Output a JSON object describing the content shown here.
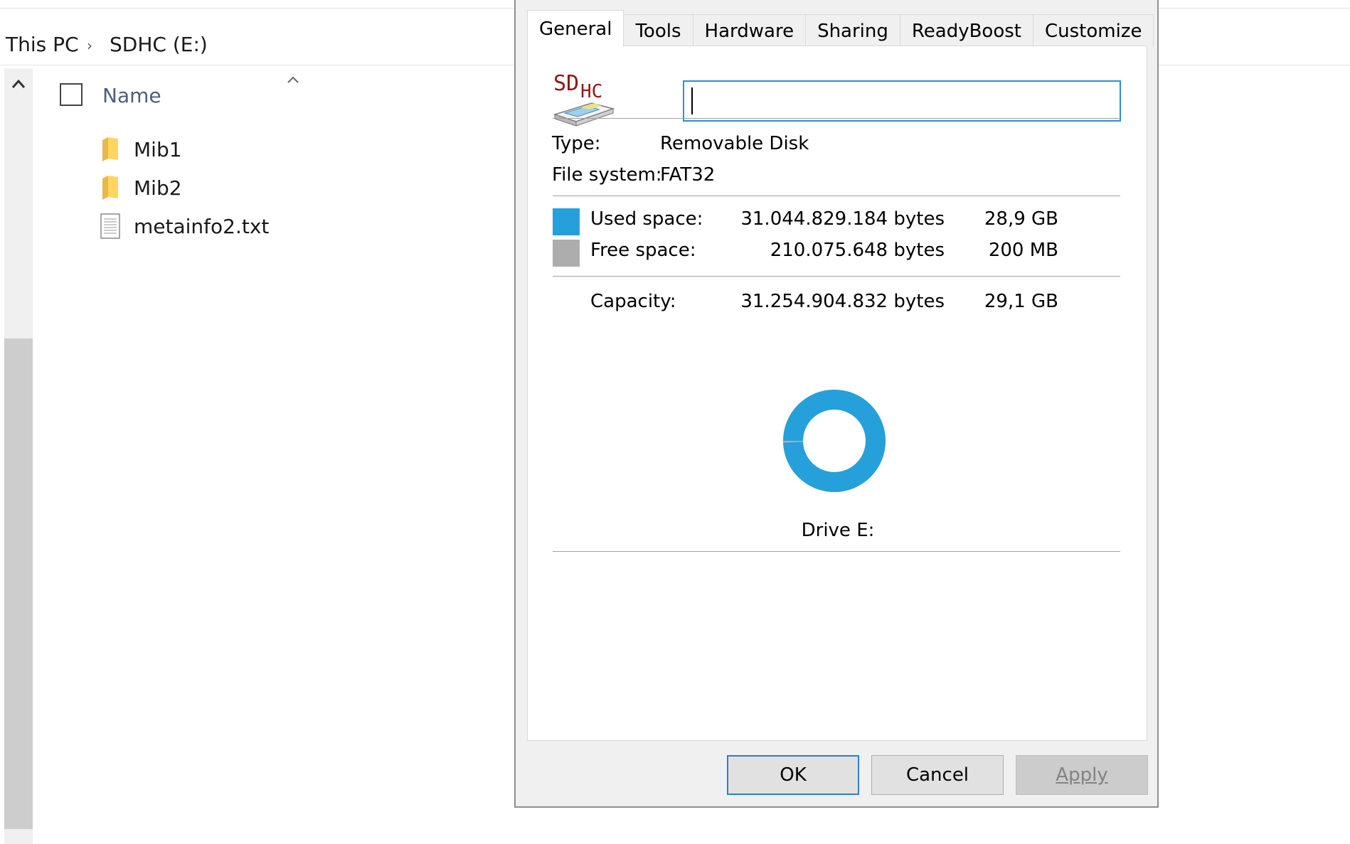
{
  "explorer": {
    "breadcrumb": [
      "This PC",
      "SDHC (E:)"
    ],
    "column_name": "Name",
    "files": [
      {
        "name": "Mib1",
        "type": "folder"
      },
      {
        "name": "Mib2",
        "type": "folder"
      },
      {
        "name": "metainfo2.txt",
        "type": "text-file"
      }
    ]
  },
  "dialog": {
    "tabs": [
      "General",
      "Tools",
      "Hardware",
      "Sharing",
      "ReadyBoost",
      "Customize"
    ],
    "active_tab": "General",
    "drive_logo": "SDHC",
    "label_value": "",
    "type_label": "Type:",
    "type_value": "Removable Disk",
    "fs_label": "File system:",
    "fs_value": "FAT32",
    "used_label": "Used space:",
    "used_bytes": "31.044.829.184 bytes",
    "used_size": "28,9 GB",
    "free_label": "Free space:",
    "free_bytes": "210.075.648 bytes",
    "free_size": "200 MB",
    "capacity_label": "Capacity:",
    "capacity_bytes": "31.254.904.832 bytes",
    "capacity_size": "29,1 GB",
    "drive_caption": "Drive E:",
    "usage_fraction": 0.9933,
    "buttons": {
      "ok": "OK",
      "cancel": "Cancel",
      "apply": "Apply"
    },
    "colors": {
      "used": "#26a0da",
      "free": "#adadad",
      "accent": "#2b7fd6"
    }
  }
}
